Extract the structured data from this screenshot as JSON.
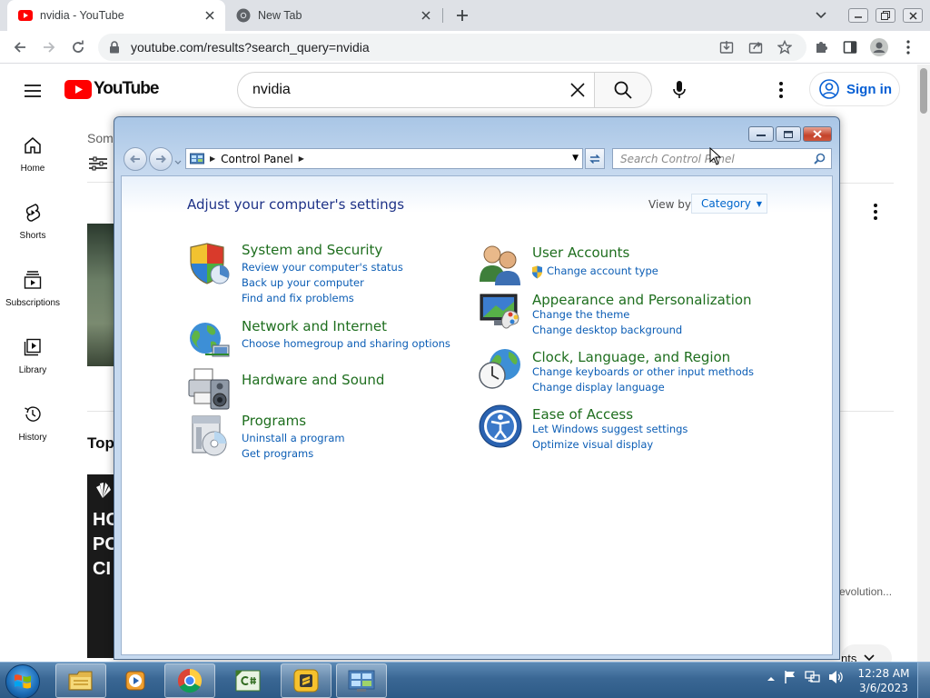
{
  "browser": {
    "tabs": [
      {
        "title": "nvidia - YouTube",
        "favicon": "youtube-icon"
      },
      {
        "title": "New Tab",
        "favicon": "chrome-icon"
      }
    ],
    "url": "youtube.com/results?search_query=nvidia"
  },
  "youtube": {
    "logo_text": "YouTube",
    "search_query": "nvidia",
    "signin_label": "Sign in",
    "guide": [
      {
        "label": "Home",
        "icon": "home-icon"
      },
      {
        "label": "Shorts",
        "icon": "shorts-icon"
      },
      {
        "label": "Subscriptions",
        "icon": "subscriptions-icon"
      },
      {
        "label": "Library",
        "icon": "library-icon"
      },
      {
        "label": "History",
        "icon": "history-icon"
      }
    ],
    "partial_some": "Som",
    "partial_top": "Top",
    "partial_revolution": "evolution...",
    "partial_nts": "nts",
    "thumb_text": [
      "HC",
      "PC",
      "CI"
    ]
  },
  "control_panel": {
    "breadcrumb": "Control Panel",
    "search_placeholder": "Search Control Panel",
    "heading": "Adjust your computer's settings",
    "view_by_label": "View by:",
    "view_by_value": "Category",
    "categories": [
      {
        "title": "System and Security",
        "icon": "shield-icon",
        "links": [
          "Review your computer's status",
          "Back up your computer",
          "Find and fix problems"
        ]
      },
      {
        "title": "Network and Internet",
        "icon": "network-globe-icon",
        "links": [
          "Choose homegroup and sharing options"
        ]
      },
      {
        "title": "Hardware and Sound",
        "icon": "printer-speaker-icon",
        "links": []
      },
      {
        "title": "Programs",
        "icon": "programs-cd-icon",
        "links": [
          "Uninstall a program",
          "Get programs"
        ]
      },
      {
        "title": "User Accounts",
        "icon": "users-icon",
        "links": [
          "Change account type"
        ]
      },
      {
        "title": "Appearance and Personalization",
        "icon": "monitor-palette-icon",
        "links": [
          "Change the theme",
          "Change desktop background"
        ]
      },
      {
        "title": "Clock, Language, and Region",
        "icon": "clock-globe-icon",
        "links": [
          "Change keyboards or other input methods",
          "Change display language"
        ]
      },
      {
        "title": "Ease of Access",
        "icon": "ease-of-access-icon",
        "links": [
          "Let Windows suggest settings",
          "Optimize visual display"
        ]
      }
    ]
  },
  "taskbar": {
    "time": "12:28 AM",
    "date": "3/6/2023",
    "apps": [
      "explorer-icon",
      "media-player-icon",
      "chrome-icon",
      "csharp-icon",
      "sublime-icon",
      "control-panel-icon"
    ]
  },
  "colors": {
    "youtube_red": "#ff0000",
    "cp_title_green": "#1e6e1e",
    "cp_link_blue": "#0b5db5",
    "cp_heading_blue": "#1e3287",
    "youtube_link_blue": "#065fd4"
  }
}
